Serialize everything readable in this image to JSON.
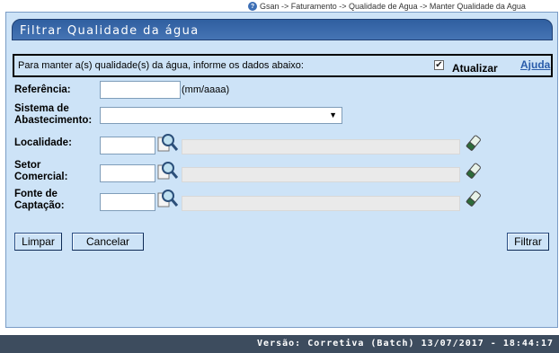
{
  "breadcrumb": {
    "text": "Gsan -> Faturamento -> Qualidade de Agua -> Manter Qualidade da Agua"
  },
  "panel": {
    "title": "Filtrar Qualidade da água"
  },
  "info": {
    "message": "Para manter a(s) qualidade(s) da água, informe os dados abaixo:",
    "atualizar_label": "Atualizar",
    "atualizar_checked": true,
    "help_link": "Ajuda"
  },
  "form": {
    "referencia": {
      "label": "Referência:",
      "value": "",
      "hint": "(mm/aaaa)"
    },
    "sistema": {
      "label_line1": "Sistema de",
      "label_line2": "Abastecimento:",
      "selected": ""
    },
    "localidade": {
      "label": "Localidade:",
      "code": "",
      "description": ""
    },
    "setor": {
      "label_line1": "Setor",
      "label_line2": "Comercial:",
      "code": "",
      "description": ""
    },
    "fonte": {
      "label_line1": "Fonte de",
      "label_line2": "Captação:",
      "code": "",
      "description": ""
    }
  },
  "buttons": {
    "limpar": "Limpar",
    "cancelar": "Cancelar",
    "filtrar": "Filtrar"
  },
  "footer": {
    "version": "Versão: Corretiva (Batch) 13/07/2017 - 18:44:17"
  },
  "icons": {
    "search": "magnifier-icon",
    "clear": "eraser-icon",
    "help": "help-icon"
  },
  "colors": {
    "panel_bg": "#cde3f7",
    "title_bar": "#3b6aaa",
    "footer_bg": "#3d4c5e",
    "link": "#2a5caa"
  }
}
